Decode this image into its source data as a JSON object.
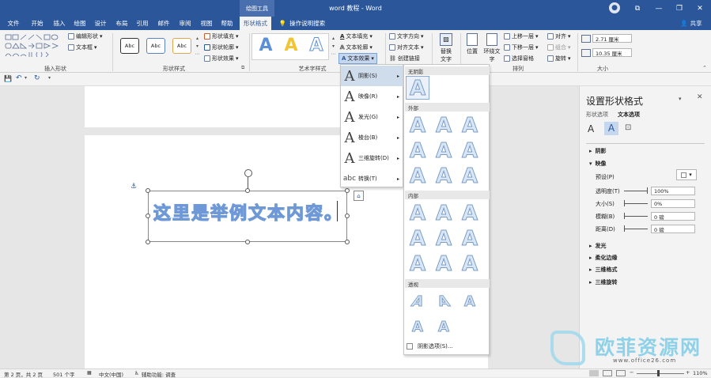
{
  "window": {
    "title": "word 教程  -  Word",
    "context_label": "绘图工具",
    "minimize": "—",
    "restore": "❐",
    "close": "✕",
    "ribbon_options": "⧉"
  },
  "tabs": [
    "文件",
    "开始",
    "插入",
    "绘图",
    "设计",
    "布局",
    "引用",
    "邮件",
    "审阅",
    "视图",
    "帮助",
    "形状格式"
  ],
  "active_tab": "形状格式",
  "tell_me": "操作说明搜索",
  "share": "共享",
  "ribbon": {
    "insert_shapes": {
      "label": "插入形状",
      "edit_shape": "编辑形状",
      "text_box": "文本框"
    },
    "shape_styles": {
      "label": "形状样式",
      "style_sample": "Abc",
      "fill": "形状填充",
      "outline": "形状轮廓",
      "effects": "形状效果"
    },
    "wordart_styles": {
      "label": "艺术字样式",
      "glyph": "A",
      "text_fill": "文本填充",
      "text_outline": "文本轮廓",
      "text_effects": "文本效果"
    },
    "text": {
      "direction": "文字方向",
      "align": "对齐文本",
      "link": "创建链接"
    },
    "alt_text": {
      "line1": "替换",
      "line2": "文字"
    },
    "arrange": {
      "label": "排列",
      "position": "位置",
      "wrap_line1": "环绕文",
      "wrap_line2": "字",
      "bring_forward": "上移一层",
      "send_backward": "下移一层",
      "selection_pane": "选择窗格",
      "align": "对齐",
      "group": "组合",
      "rotate": "旋转"
    },
    "size": {
      "label": "大小",
      "height": "2.71 厘米",
      "width": "10.35 厘米"
    }
  },
  "document": {
    "textbox_text": "这里是举例文本内容。"
  },
  "text_effects_menu": {
    "items": [
      {
        "glyph": "A",
        "label": "阴影(S)"
      },
      {
        "glyph": "A",
        "label": "映像(R)"
      },
      {
        "glyph": "A",
        "label": "发光(G)"
      },
      {
        "glyph": "A",
        "label": "棱台(B)"
      },
      {
        "glyph": "A",
        "label": "三维旋转(D)"
      },
      {
        "glyph": "abc",
        "label": "转换(T)"
      }
    ],
    "arrow": "▸"
  },
  "shadow_gallery": {
    "sections": {
      "none": "无阴影",
      "outer": "外部",
      "inner": "内部",
      "perspective": "透视"
    },
    "glyph": "A",
    "options_link": "阴影选项(S)..."
  },
  "format_pane": {
    "title": "设置形状格式",
    "tab_shape": "形状选项",
    "tab_text": "文本选项",
    "sections": [
      "阴影",
      "映像",
      "发光",
      "柔化边缘",
      "三维格式",
      "三维旋转"
    ],
    "expanded_section": "映像",
    "preset_label": "预设(P)",
    "rows": [
      {
        "label": "透明度(T)",
        "value": "100%"
      },
      {
        "label": "大小(S)",
        "value": "0%"
      },
      {
        "label": "模糊(B)",
        "value": "0 磅"
      },
      {
        "label": "距离(D)",
        "value": "0 磅"
      }
    ],
    "collapsed_arrow": "▸",
    "expanded_arrow": "▾"
  },
  "status_bar": {
    "page": "第 2 页，共 2 页",
    "words": "501 个字",
    "language": "中文(中国)",
    "accessibility": "辅助功能: 调查",
    "zoom": "110%"
  },
  "watermark": {
    "cn": "欧菲资源网",
    "url": "www.office26.com"
  },
  "colors": {
    "title_bar": "#2b579a",
    "text_blue": "#6e99d6",
    "watermark": "#8fd1e8"
  }
}
